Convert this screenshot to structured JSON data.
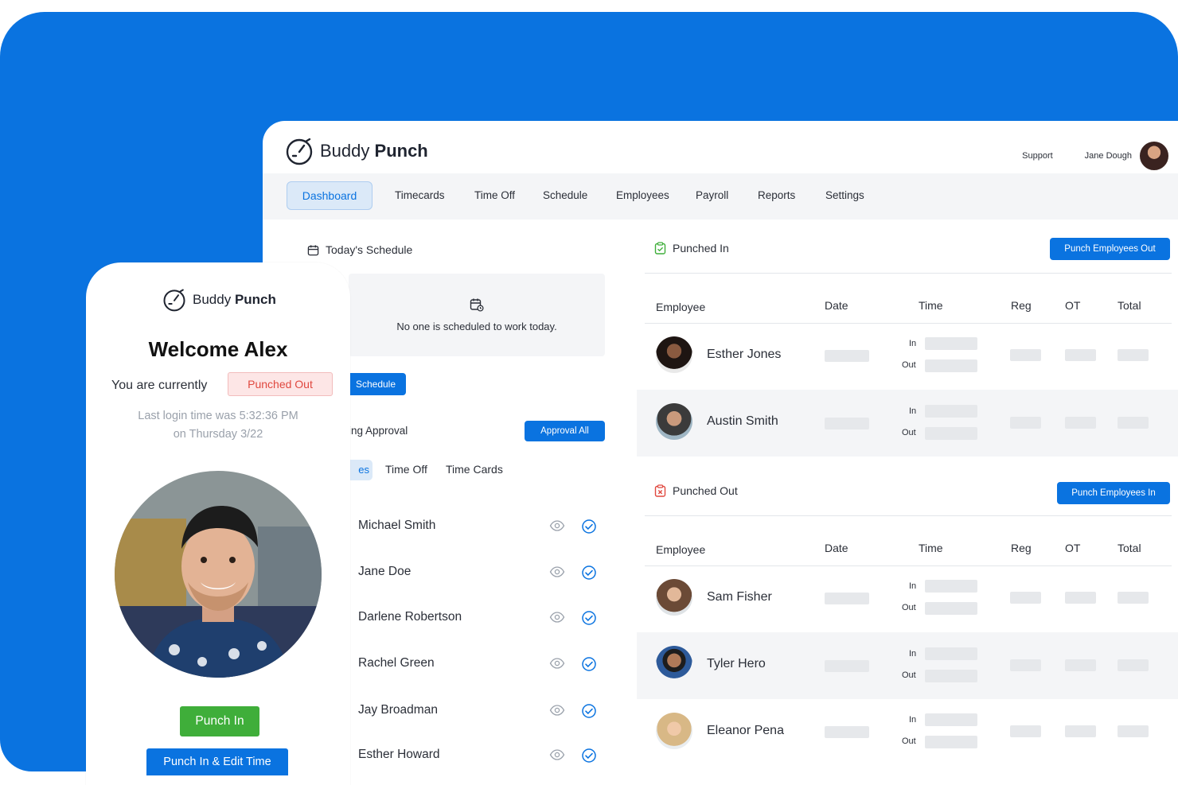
{
  "brand": {
    "word1": "Buddy",
    "word2": "Punch"
  },
  "header": {
    "support": "Support",
    "user_name": "Jane Dough"
  },
  "nav": [
    "Dashboard",
    "Timecards",
    "Time Off",
    "Schedule",
    "Employees",
    "Payroll",
    "Reports",
    "Settings"
  ],
  "schedule": {
    "title": "Today's Schedule",
    "empty_text": "No one is scheduled to work today.",
    "button": "Schedule"
  },
  "approval": {
    "title": "ing Approval",
    "button": "Approval All",
    "tabs": [
      "es",
      "Time Off",
      "Time Cards"
    ],
    "people": [
      "Michael Smith",
      "Jane Doe",
      "Darlene Robertson",
      "Rachel Green",
      "Jay Broadman",
      "Esther Howard"
    ]
  },
  "punched_in": {
    "title": "Punched In",
    "button": "Punch Employees Out",
    "columns": [
      "Employee",
      "Date",
      "Time",
      "Reg",
      "OT",
      "Total"
    ],
    "rows": [
      {
        "name": "Esther Jones",
        "in_label": "In",
        "out_label": "Out"
      },
      {
        "name": "Austin Smith",
        "in_label": "In",
        "out_label": "Out"
      }
    ]
  },
  "punched_out": {
    "title": "Punched Out",
    "button": "Punch Employees In",
    "columns": [
      "Employee",
      "Date",
      "Time",
      "Reg",
      "OT",
      "Total"
    ],
    "rows": [
      {
        "name": "Sam Fisher",
        "in_label": "In",
        "out_label": "Out"
      },
      {
        "name": "Tyler Hero",
        "in_label": "In",
        "out_label": "Out"
      },
      {
        "name": "Eleanor Pena",
        "in_label": "In",
        "out_label": "Out"
      }
    ]
  },
  "mobile": {
    "welcome": "Welcome Alex",
    "status_prefix": "You are currently",
    "status_badge": "Punched Out",
    "last_login_line1": "Last login time was 5:32:36 PM",
    "last_login_line2": "on Thursday 3/22",
    "punch_in": "Punch In",
    "punch_edit": "Punch In & Edit Time"
  },
  "colors": {
    "accent": "#0a73e0",
    "success": "#3fae3a",
    "danger": "#e0483f"
  }
}
